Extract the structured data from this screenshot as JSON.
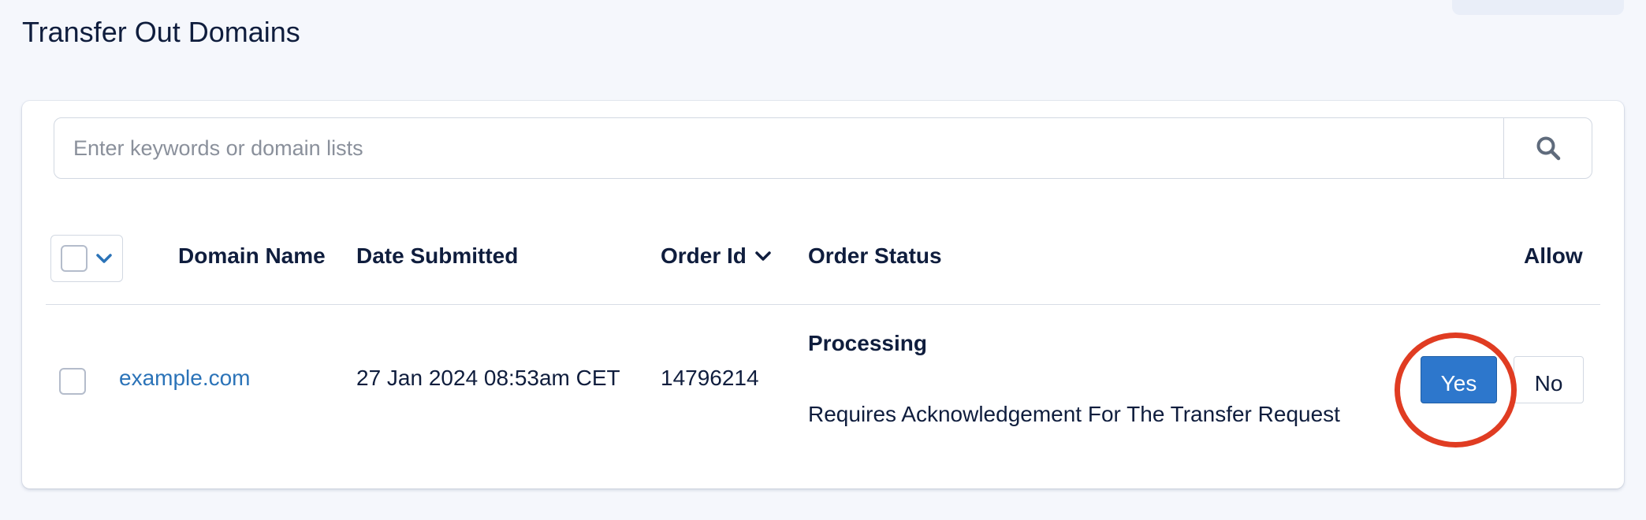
{
  "page": {
    "title": "Transfer Out Domains"
  },
  "search": {
    "placeholder": "Enter keywords or domain lists",
    "value": "",
    "button_icon": "search-icon"
  },
  "table": {
    "columns": {
      "domain_name": "Domain Name",
      "date_submitted": "Date Submitted",
      "order_id": "Order Id",
      "order_status": "Order Status",
      "allow": "Allow"
    },
    "rows": [
      {
        "domain_name": "example.com",
        "date_submitted": "27 Jan 2024 08:53am CET",
        "order_id": "14796214",
        "status_title": "Processing",
        "status_detail": "Requires Acknowledgement For The Transfer Request",
        "allow_yes": "Yes",
        "allow_no": "No"
      }
    ]
  },
  "colors": {
    "accent": "#2d77cc",
    "link": "#2b73b8",
    "highlight": "#e03c22",
    "text": "#0f1d3d"
  }
}
